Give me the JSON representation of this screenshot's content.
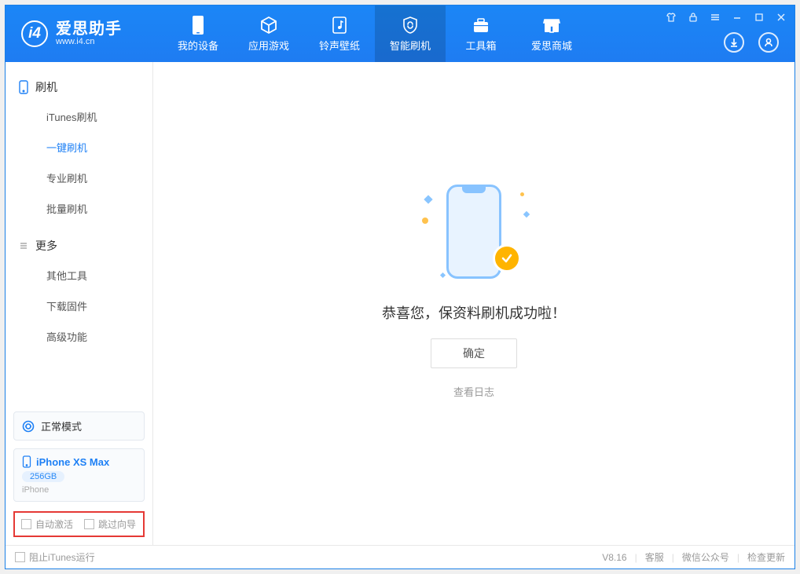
{
  "app": {
    "name": "爱思助手",
    "domain": "www.i4.cn"
  },
  "nav": [
    {
      "label": "我的设备"
    },
    {
      "label": "应用游戏"
    },
    {
      "label": "铃声壁纸"
    },
    {
      "label": "智能刷机"
    },
    {
      "label": "工具箱"
    },
    {
      "label": "爱思商城"
    }
  ],
  "sidebar": {
    "group1": {
      "title": "刷机",
      "items": [
        {
          "label": "iTunes刷机"
        },
        {
          "label": "一键刷机"
        },
        {
          "label": "专业刷机"
        },
        {
          "label": "批量刷机"
        }
      ]
    },
    "group2": {
      "title": "更多",
      "items": [
        {
          "label": "其他工具"
        },
        {
          "label": "下载固件"
        },
        {
          "label": "高级功能"
        }
      ]
    }
  },
  "device": {
    "mode": "正常模式",
    "name": "iPhone XS Max",
    "capacity": "256GB",
    "type": "iPhone"
  },
  "options": {
    "auto_activate": "自动激活",
    "skip_guide": "跳过向导"
  },
  "main": {
    "message": "恭喜您，保资料刷机成功啦！",
    "confirm": "确定",
    "view_log": "查看日志"
  },
  "footer": {
    "block_itunes": "阻止iTunes运行",
    "version": "V8.16",
    "support": "客服",
    "wechat": "微信公众号",
    "check_update": "检查更新"
  }
}
